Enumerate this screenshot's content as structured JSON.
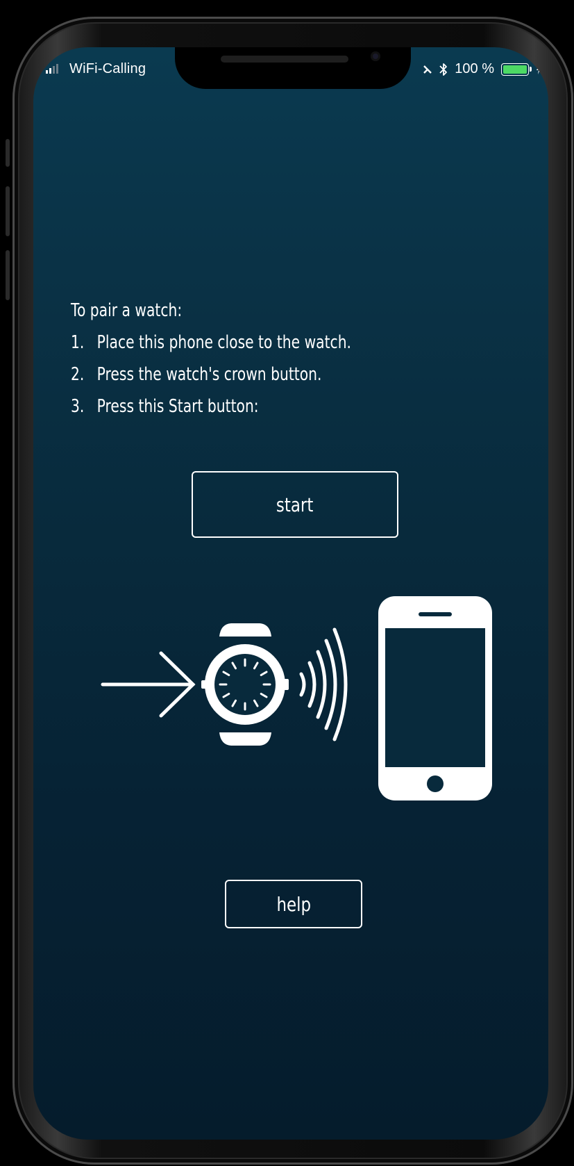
{
  "status_bar": {
    "carrier": "WiFi-Calling",
    "battery_text": "100 %",
    "battery_level": 1.0,
    "icons": [
      "signal-icon",
      "alarm-icon",
      "bluetooth-icon",
      "battery-icon",
      "charging-icon"
    ]
  },
  "pairing": {
    "intro": "To pair a watch:",
    "steps": [
      {
        "num": "1.",
        "text": "Place this phone close to the watch."
      },
      {
        "num": "2.",
        "text": "Press the watch's crown button."
      },
      {
        "num": "3.",
        "text": "Press this Start button:"
      }
    ],
    "start_label": "start",
    "help_label": "help"
  },
  "illustration": {
    "icons": [
      "arrow-right-icon",
      "watch-icon",
      "signal-waves-icon",
      "smartphone-icon"
    ]
  },
  "colors": {
    "background_top": "#0a3a50",
    "background_bottom": "#051c2c",
    "foreground": "#ffffff",
    "battery_fill": "#4cd964"
  }
}
